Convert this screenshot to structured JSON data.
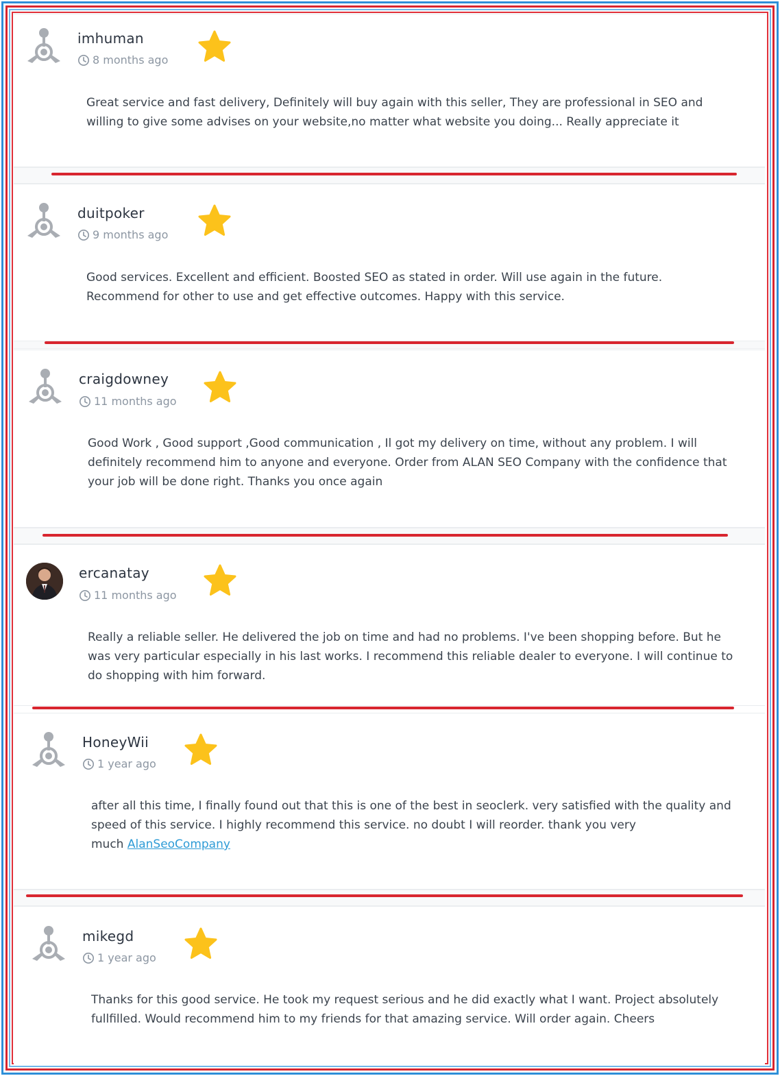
{
  "colors": {
    "star": "#fcc21b",
    "divider": "#d8262f",
    "link": "#2e9bd6"
  },
  "reviews": [
    {
      "user": "imhuman",
      "time": "8 months ago",
      "rating": 1,
      "avatar": "default-avatar-icon",
      "text": "Great service and fast delivery, Definitely will buy again with this seller, They are professional in SEO and willing to give some advises on your website,no matter what website you doing... Really appreciate it"
    },
    {
      "user": "duitpoker",
      "time": "9 months ago",
      "rating": 1,
      "avatar": "default-avatar-icon",
      "text": "Good services. Excellent and efficient. Boosted SEO as stated in order. Will use again in the future. Recommend for other to use and get effective outcomes. Happy with this service."
    },
    {
      "user": "craigdowney",
      "time": "11 months ago",
      "rating": 1,
      "avatar": "default-avatar-icon",
      "text": "Good Work , Good support ,Good communication , Il got my delivery on time, without any problem. I will definitely recommend him to anyone and everyone. Order from ALAN SEO Company with the confidence that your job will be done right. Thanks you once again"
    },
    {
      "user": "ercanatay",
      "time": "11 months ago",
      "rating": 1,
      "avatar": "user-photo",
      "text": "Really a reliable seller. He delivered the job on time and had no problems. I've been shopping before. But he was very particular especially in his last works. I recommend this reliable dealer to everyone. I will continue to do shopping with him forward."
    },
    {
      "user": "HoneyWii",
      "time": "1 year ago",
      "rating": 1,
      "avatar": "default-avatar-icon",
      "text_line1": "after all this time, I finally found out that this is one of the best in seoclerk. very satisfied with the quality and",
      "text_line2": "speed of this service. I highly recommend this service. no doubt I will reorder. thank you very",
      "text_prefix": "much ",
      "link": "AlanSeoCompany"
    },
    {
      "user": "mikegd",
      "time": "1 year ago",
      "rating": 1,
      "avatar": "default-avatar-icon",
      "text": "Thanks for this good service. He took my request serious and he did exactly what I want. Project absolutely fullfilled. Would recommend him to my friends for that amazing service. Will order again. Cheers"
    }
  ]
}
